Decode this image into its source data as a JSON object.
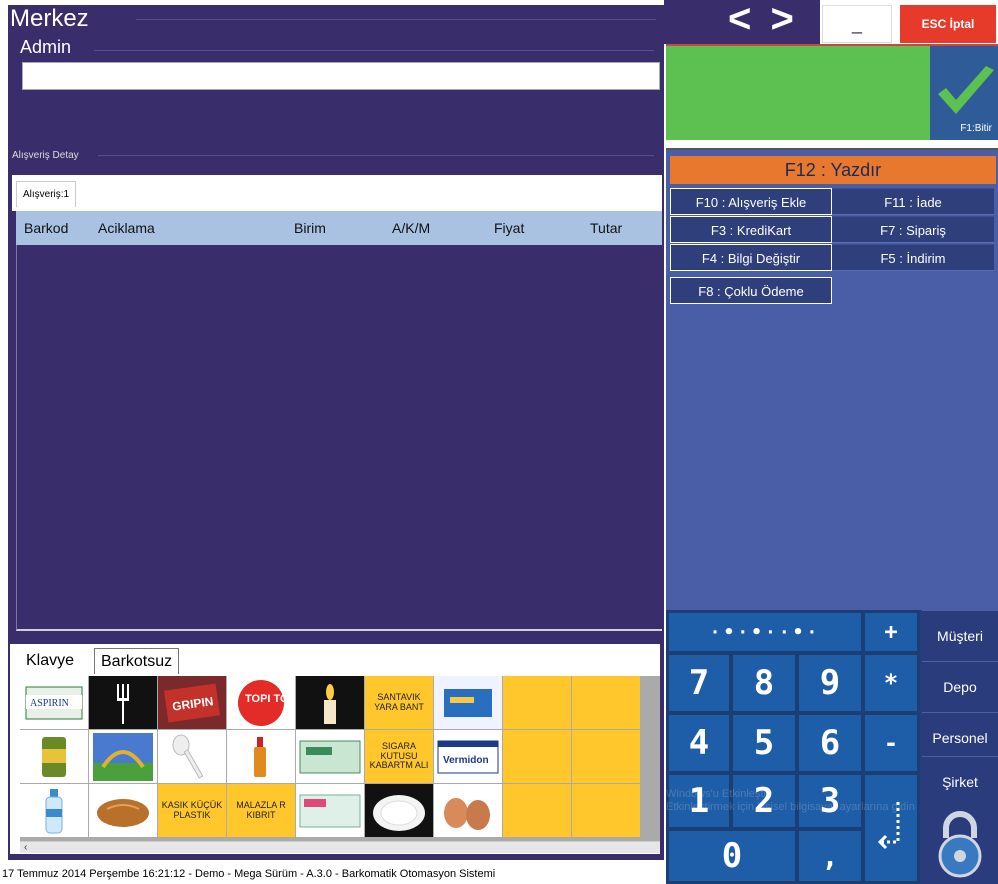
{
  "header": {
    "store_name": "Merkez",
    "user_name": "Admin",
    "nav_arrows": "< >",
    "minimize_label": "_",
    "cancel_label": "ESC İptal"
  },
  "finish": {
    "label": "F1:Bitir"
  },
  "detail": {
    "title": "Alışveriş Detay",
    "tab_label": "Alışveriş:1",
    "columns": [
      "Barkod",
      "Aciklama",
      "Birim",
      "A/K/M",
      "Fiyat",
      "Tutar"
    ]
  },
  "function_keys": {
    "print": "F12 : Yazdır",
    "buttons": [
      "F10 : Alışveriş Ekle",
      "F11 : İade",
      "F3 : KrediKart",
      "F7 : Sipariş",
      "F4 : Bilgi Değiştir",
      "F5 : İndirim",
      "F8 : Çoklu Ödeme"
    ]
  },
  "numpad": {
    "keys": [
      "7",
      "8",
      "9",
      "4",
      "5",
      "6",
      "1",
      "2",
      "3",
      "0",
      ","
    ],
    "ops": [
      "+",
      "*",
      "-"
    ]
  },
  "side_buttons": [
    "Müşteri",
    "Depo",
    "Personel",
    "Şirket"
  ],
  "keyboard_tabs": [
    "Klavye",
    "Barkotsuz"
  ],
  "products": {
    "text_labels": {
      "santavik": "SANTAVIK YARA BANT",
      "sigara": "SIGARA KUTUSU KABARTM ALI",
      "kasik": "KASIK KÜÇÜK PLASTIK",
      "malazla": "MALAZLA R KIBRIT"
    },
    "product_brands": {
      "aspirin": "ASPIRIN",
      "gripin": "GRIPIN",
      "topitop": "TOPI TOP",
      "vermidon": "Vermidon"
    }
  },
  "watermark": {
    "line1": "Windows'u Etkinleştir",
    "line2": "Etkinleştirmek için kişisel bilgisayar ayarlarına gidin"
  },
  "status_bar": "17 Temmuz 2014 Perşembe 16:21:12 -  Demo  - Mega Sürüm  -   A.3.0 - Barkomatik  Otomasyon Sistemi",
  "colors": {
    "panel_bg": "#3a2d6b",
    "grid_header": "#a9c2e2",
    "cancel": "#e63a2a",
    "total": "#5cc151",
    "print": "#e8782e",
    "product_yellow": "#ffc72c"
  }
}
